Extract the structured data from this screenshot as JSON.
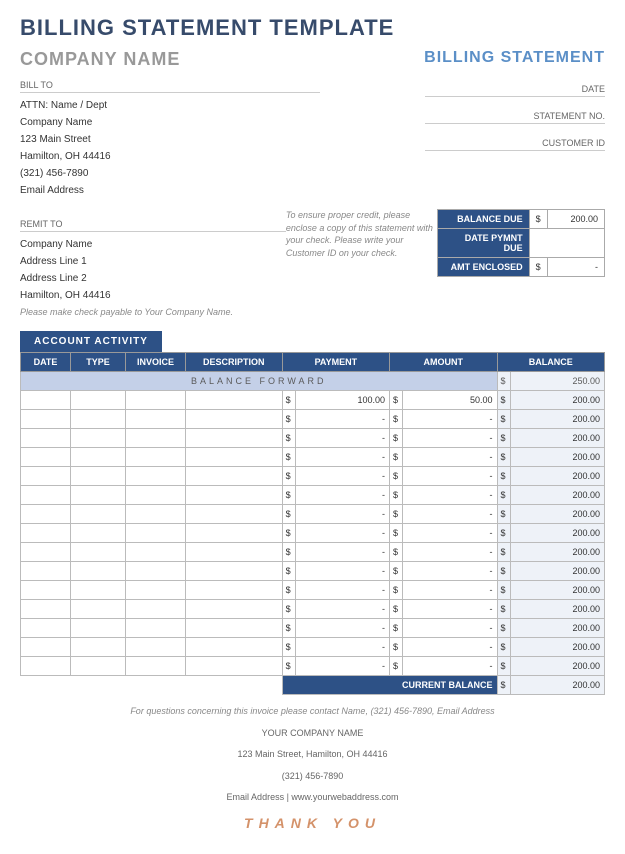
{
  "title": "BILLING STATEMENT TEMPLATE",
  "company_name": "COMPANY NAME",
  "billing_statement": "BILLING STATEMENT",
  "bill_to": {
    "label": "BILL TO",
    "lines": [
      "ATTN: Name / Dept",
      "Company Name",
      "123 Main Street",
      "Hamilton, OH  44416",
      "(321) 456-7890",
      "Email Address"
    ]
  },
  "remit_to": {
    "label": "REMIT TO",
    "lines": [
      "Company Name",
      "Address Line 1",
      "Address Line 2",
      "Hamilton, OH  44416"
    ],
    "note": "Please make check payable to  Your Company Name."
  },
  "meta": {
    "date": "DATE",
    "stmt": "STATEMENT NO.",
    "cust": "CUSTOMER ID"
  },
  "credit_note": "To ensure proper credit, please enclose a copy of this statement with your check.  Please write your Customer ID on your check.",
  "balance_box": {
    "balance_due": {
      "label": "BALANCE DUE",
      "cur": "$",
      "val": "200.00"
    },
    "date_pmt": {
      "label": "DATE PYMNT DUE",
      "cur": "",
      "val": ""
    },
    "amt_enc": {
      "label": "AMT ENCLOSED",
      "cur": "$",
      "val": "-"
    }
  },
  "activity_tab": "ACCOUNT ACTIVITY",
  "headers": [
    "DATE",
    "TYPE",
    "INVOICE",
    "DESCRIPTION",
    "PAYMENT",
    "AMOUNT",
    "BALANCE"
  ],
  "balance_forward": "BALANCE  FORWARD",
  "fwd_balance": {
    "cur": "$",
    "val": "250.00"
  },
  "rows": [
    {
      "payment": "100.00",
      "amount": "50.00",
      "balance": "200.00"
    },
    {
      "payment": "-",
      "amount": "-",
      "balance": "200.00"
    },
    {
      "payment": "-",
      "amount": "-",
      "balance": "200.00"
    },
    {
      "payment": "-",
      "amount": "-",
      "balance": "200.00"
    },
    {
      "payment": "-",
      "amount": "-",
      "balance": "200.00"
    },
    {
      "payment": "-",
      "amount": "-",
      "balance": "200.00"
    },
    {
      "payment": "-",
      "amount": "-",
      "balance": "200.00"
    },
    {
      "payment": "-",
      "amount": "-",
      "balance": "200.00"
    },
    {
      "payment": "-",
      "amount": "-",
      "balance": "200.00"
    },
    {
      "payment": "-",
      "amount": "-",
      "balance": "200.00"
    },
    {
      "payment": "-",
      "amount": "-",
      "balance": "200.00"
    },
    {
      "payment": "-",
      "amount": "-",
      "balance": "200.00"
    },
    {
      "payment": "-",
      "amount": "-",
      "balance": "200.00"
    },
    {
      "payment": "-",
      "amount": "-",
      "balance": "200.00"
    },
    {
      "payment": "-",
      "amount": "-",
      "balance": "200.00"
    }
  ],
  "current_balance": {
    "label": "CURRENT BALANCE",
    "cur": "$",
    "val": "200.00"
  },
  "footer": {
    "q": "For questions concerning this invoice please contact  Name, (321) 456-7890, Email Address",
    "cname": "YOUR COMPANY NAME",
    "addr": "123 Main Street, Hamilton, OH 44416",
    "phone": "(321) 456-7890",
    "email": "Email Address | www.yourwebaddress.com",
    "thanks": "THANK  YOU"
  },
  "cur": "$"
}
